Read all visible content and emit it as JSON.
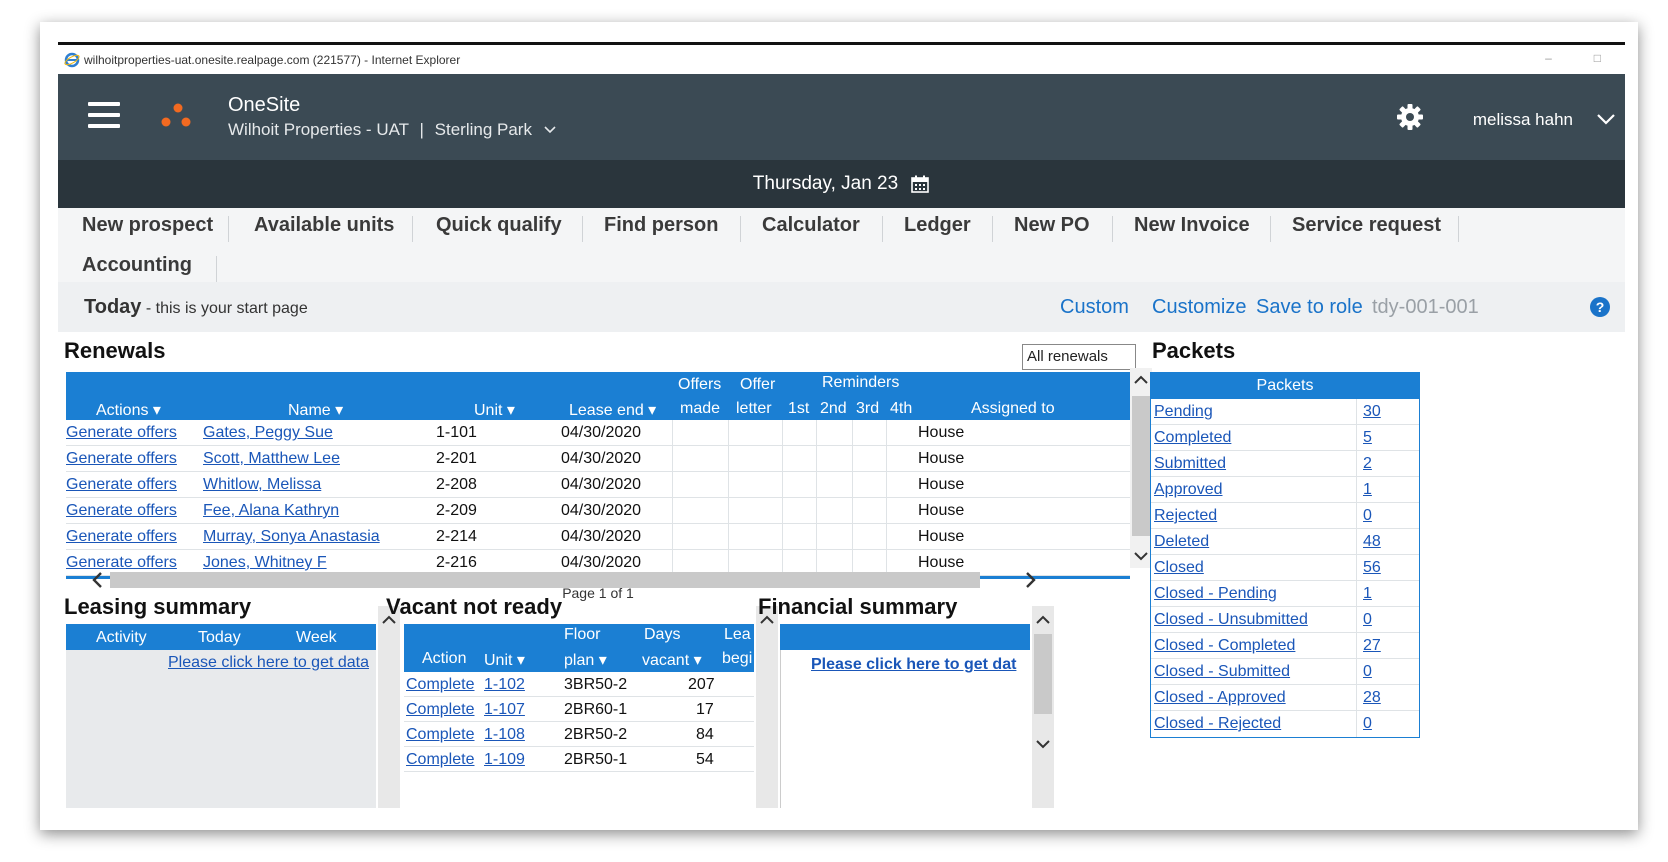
{
  "window": {
    "title": "wilhoitproperties-uat.onesite.realpage.com (221577) - Internet Explorer",
    "min_glyph": "–",
    "max_glyph": "□"
  },
  "header": {
    "app_name": "OneSite",
    "company": "Wilhoit Properties - UAT",
    "separator": "|",
    "property": "Sterling Park",
    "user": "melissa hahn"
  },
  "date_bar": {
    "date": "Thursday, Jan 23"
  },
  "quicklinks": [
    "New prospect",
    "Available units",
    "Quick qualify",
    "Find person",
    "Calculator",
    "Ledger",
    "New PO",
    "New Invoice",
    "Service request",
    "Accounting"
  ],
  "today": {
    "title": "Today",
    "subtitle": " - this is your start page",
    "links": [
      "Custom",
      "Customize",
      "Save to role"
    ],
    "code": "tdy-001-001"
  },
  "renewals": {
    "title": "Renewals",
    "filter": "All renewals",
    "headers": {
      "actions": "Actions",
      "name": "Name",
      "unit": "Unit",
      "lease_end": "Lease end",
      "offers_1": "Offers",
      "offers_2": "made",
      "offer_1": "Offer",
      "offer_2": "letter",
      "reminders": "Reminders",
      "r1": "1st",
      "r2": "2nd",
      "r3": "3rd",
      "r4": "4th",
      "assigned": "Assigned to"
    },
    "rows": [
      {
        "action": "Generate offers",
        "name": "Gates, Peggy Sue",
        "unit": "1-101",
        "lease_end": "04/30/2020",
        "assigned": "House"
      },
      {
        "action": "Generate offers",
        "name": "Scott, Matthew Lee",
        "unit": "2-201",
        "lease_end": "04/30/2020",
        "assigned": "House"
      },
      {
        "action": "Generate offers",
        "name": "Whitlow, Melissa ",
        "unit": "2-208",
        "lease_end": "04/30/2020",
        "assigned": "House"
      },
      {
        "action": "Generate offers",
        "name": "Fee, Alana Kathryn",
        "unit": "2-209",
        "lease_end": "04/30/2020",
        "assigned": "House"
      },
      {
        "action": "Generate offers",
        "name": "Murray, Sonya Anastasia",
        "unit": "2-214",
        "lease_end": "04/30/2020",
        "assigned": "House"
      },
      {
        "action": "Generate offers",
        "name": "Jones, Whitney F",
        "unit": "2-216",
        "lease_end": "04/30/2020",
        "assigned": "House"
      }
    ],
    "pager": "Page 1 of 1"
  },
  "packets": {
    "title": "Packets",
    "header": "Packets",
    "rows": [
      {
        "label": "Pending",
        "count": "30"
      },
      {
        "label": "Completed",
        "count": "5"
      },
      {
        "label": "Submitted",
        "count": "2"
      },
      {
        "label": "Approved",
        "count": "1"
      },
      {
        "label": "Rejected",
        "count": "0"
      },
      {
        "label": "Deleted",
        "count": "48"
      },
      {
        "label": "Closed",
        "count": "56"
      },
      {
        "label": "Closed - Pending",
        "count": "1"
      },
      {
        "label": "Closed - Unsubmitted",
        "count": "0"
      },
      {
        "label": "Closed - Completed",
        "count": "27"
      },
      {
        "label": "Closed - Submitted",
        "count": "0"
      },
      {
        "label": "Closed - Approved",
        "count": "28"
      },
      {
        "label": "Closed - Rejected",
        "count": "0"
      }
    ]
  },
  "leasing_summary": {
    "title": "Leasing summary",
    "headers": [
      "Activity",
      "Today",
      "Week"
    ],
    "link": "Please click here to get data"
  },
  "vacant_not_ready": {
    "title": "Vacant not ready",
    "headers": {
      "action": "Action",
      "unit": "Unit",
      "floor_1": "Floor",
      "floor_2": "plan",
      "days_1": "Days",
      "days_2": "vacant",
      "lease_1": "Lea",
      "lease_2": "begi"
    },
    "rows": [
      {
        "action": "Complete",
        "unit": "1-102",
        "plan": "3BR50-2",
        "days": "207"
      },
      {
        "action": "Complete",
        "unit": "1-107",
        "plan": "2BR60-1",
        "days": "17"
      },
      {
        "action": "Complete",
        "unit": "1-108",
        "plan": "2BR50-2",
        "days": "84"
      },
      {
        "action": "Complete",
        "unit": "1-109",
        "plan": "2BR50-1",
        "days": "54"
      }
    ]
  },
  "financial_summary": {
    "title": "Financial summary",
    "link": "Please click here to get dat"
  },
  "colors": {
    "header_bg": "#3b4a54",
    "date_bar_bg": "#2a353c",
    "table_header": "#1b7fd3",
    "link": "#1a56b8",
    "logo_orange": "#f26a21"
  }
}
